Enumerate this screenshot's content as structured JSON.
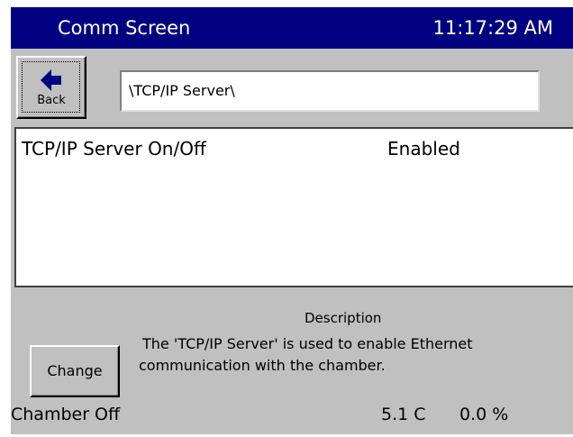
{
  "titlebar": {
    "title": "Comm Screen",
    "clock": "11:17:29 AM",
    "bg_color": "#000080"
  },
  "back_button": {
    "icon": "left-arrow-icon",
    "label": "Back"
  },
  "path_field": {
    "value": "\\TCP/IP Server\\"
  },
  "settings": [
    {
      "name": "TCP/IP Server On/Off",
      "value": "Enabled"
    }
  ],
  "description": {
    "title": "Description",
    "line1": "The 'TCP/IP Server' is used to enable Ethernet",
    "line2": "communication with the chamber."
  },
  "change_button": {
    "label": "Change"
  },
  "status_bar": {
    "state": "Chamber Off",
    "temperature": "5.1 C",
    "humidity": "0.0 %"
  }
}
